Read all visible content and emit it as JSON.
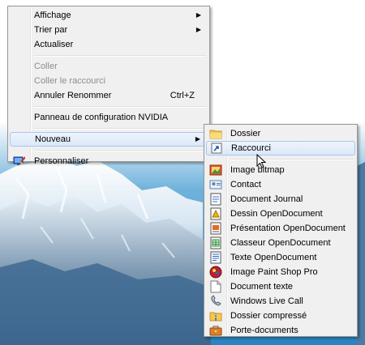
{
  "context_menu": {
    "affichage": "Affichage",
    "trier_par": "Trier par",
    "actualiser": "Actualiser",
    "coller": "Coller",
    "coller_raccourci": "Coller le raccourci",
    "annuler": "Annuler Renommer",
    "annuler_shortcut": "Ctrl+Z",
    "nvidia": "Panneau de configuration NVIDIA",
    "nouveau": "Nouveau",
    "personnaliser": "Personnaliser"
  },
  "submenu": {
    "items": [
      {
        "label": "Dossier",
        "icon": "folder-icon"
      },
      {
        "label": "Raccourci",
        "icon": "shortcut-icon"
      },
      {
        "label": "Image bitmap",
        "icon": "bitmap-icon"
      },
      {
        "label": "Contact",
        "icon": "contact-icon"
      },
      {
        "label": "Document Journal",
        "icon": "journal-icon"
      },
      {
        "label": "Dessin OpenDocument",
        "icon": "drawing-icon"
      },
      {
        "label": "Présentation OpenDocument",
        "icon": "presentation-icon"
      },
      {
        "label": "Classeur OpenDocument",
        "icon": "spreadsheet-icon"
      },
      {
        "label": "Texte OpenDocument",
        "icon": "text-document-icon"
      },
      {
        "label": "Image Paint Shop Pro",
        "icon": "paint-shop-pro-icon"
      },
      {
        "label": "Document texte",
        "icon": "text-file-icon"
      },
      {
        "label": "Windows Live Call",
        "icon": "phone-icon"
      },
      {
        "label": "Dossier compressé",
        "icon": "zip-folder-icon"
      },
      {
        "label": "Porte-documents",
        "icon": "briefcase-icon"
      }
    ]
  },
  "colors": {
    "menu_bg": "#f0f0f0",
    "highlight_border": "#a8c6ec",
    "disabled_text": "#8d8d8d"
  }
}
